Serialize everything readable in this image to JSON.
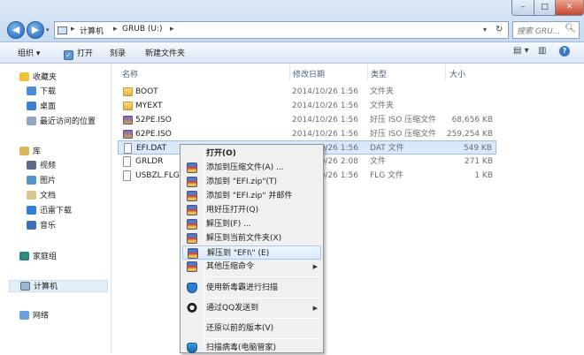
{
  "window": {
    "min_glyph": "–",
    "max_glyph": "□",
    "close_glyph": "✕"
  },
  "nav": {
    "back_glyph": "◀",
    "forward_glyph": "▶",
    "dropdown_glyph": "▾"
  },
  "address": {
    "crumbs": [
      "计算机",
      "GRUB (U:)"
    ],
    "separator": "▸",
    "dropdown_glyph": "▾",
    "refresh_glyph": "↻"
  },
  "search": {
    "placeholder": "搜索 GRU...",
    "icon": "search-icon"
  },
  "toolbar": {
    "organize": "组织 ▾",
    "open": "打开",
    "burn": "刻录",
    "new_folder": "新建文件夹",
    "view_glyph": "▤ ▾",
    "pane_glyph": "▥",
    "help_glyph": "?"
  },
  "sidebar": {
    "favorites": "收藏夹",
    "favorites_items": [
      "下载",
      "桌面",
      "最近访问的位置"
    ],
    "libraries": "库",
    "libraries_items": [
      "视频",
      "图片",
      "文档",
      "迅雷下载",
      "音乐"
    ],
    "homegroup": "家庭组",
    "computer": "计算机",
    "network": "网络"
  },
  "columns": {
    "name": "名称",
    "date": "修改日期",
    "type": "类型",
    "size": "大小"
  },
  "files": [
    {
      "name": "BOOT",
      "date": "2014/10/26 1:56",
      "type": "文件夹",
      "size": "",
      "kind": "folder"
    },
    {
      "name": "MYEXT",
      "date": "2014/10/26 1:56",
      "type": "文件夹",
      "size": "",
      "kind": "folder"
    },
    {
      "name": "52PE.ISO",
      "date": "2014/10/26 1:56",
      "type": "好压 ISO 压缩文件",
      "size": "68,656 KB",
      "kind": "iso"
    },
    {
      "name": "62PE.ISO",
      "date": "2014/10/26 1:56",
      "type": "好压 ISO 压缩文件",
      "size": "259,254 KB",
      "kind": "iso"
    },
    {
      "name": "EFI.DAT",
      "date": "2014/10/26 1:56",
      "type": "DAT 文件",
      "size": "549 KB",
      "kind": "doc"
    },
    {
      "name": "GRLDR",
      "date": "2014/10/26 2:08",
      "type": "文件",
      "size": "271 KB",
      "kind": "doc"
    },
    {
      "name": "USBZL.FLG",
      "date": "2014/10/26 1:56",
      "type": "FLG 文件",
      "size": "1 KB",
      "kind": "doc"
    }
  ],
  "context_menu": {
    "open": "打开(O)",
    "add_archive": "添加到压缩文件(A) ...",
    "add_zip": "添加到 \"EFI.zip\"(T)",
    "add_zip_mail": "添加到 \"EFI.zip\" 并邮件",
    "open_with_haozip": "用好压打开(Q)",
    "extract_to": "解压到(F) ...",
    "extract_here": "解压到当前文件夹(X)",
    "extract_to_efi": "解压到 \"EFI\\\" (E)",
    "other_commands": "其他压缩命令",
    "scan_virus": "使用新毒霸进行扫描",
    "send_qq": "通过QQ发送到",
    "restore_previous": "还原以前的版本(V)",
    "scan_guard": "扫描病毒(电脑管家)",
    "submenu_glyph": "▶"
  }
}
